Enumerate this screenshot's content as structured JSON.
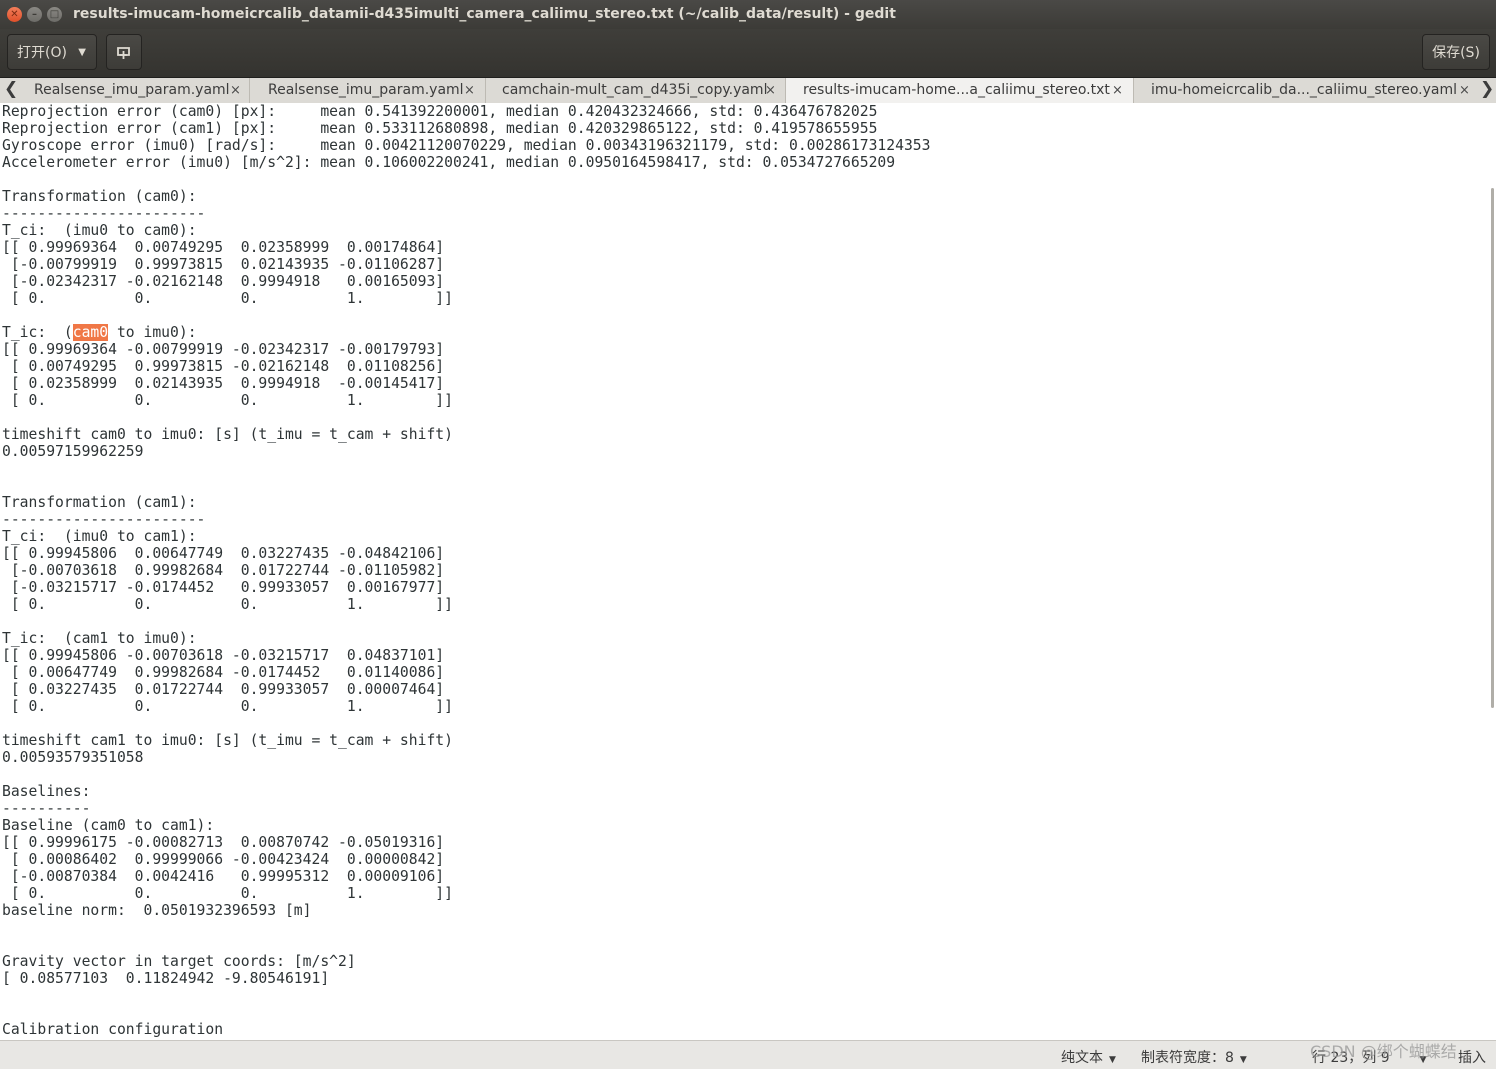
{
  "window": {
    "title": "results-imucam-homeicrcalib_datamii-d435imulti_camera_caliimu_stereo.txt (~/calib_data/result) - gedit"
  },
  "toolbar": {
    "open_label": "打开(O)",
    "save_label": "保存(S)"
  },
  "tabs": [
    {
      "label": "Realsense_imu_param.yaml",
      "active": false
    },
    {
      "label": "Realsense_imu_param.yaml",
      "active": false
    },
    {
      "label": "camchain-mult_cam_d435i_copy.yaml",
      "active": false
    },
    {
      "label": "results-imucam-home...a_caliimu_stereo.txt",
      "active": true
    },
    {
      "label": "imu-homeicrcalib_da..._caliimu_stereo.yaml",
      "active": false
    }
  ],
  "tab_close_glyph": "×",
  "editor": {
    "highlight": "cam0",
    "lines": [
      "Reprojection error (cam0) [px]:     mean 0.541392200001, median 0.420432324666, std: 0.436476782025",
      "Reprojection error (cam1) [px]:     mean 0.533112680898, median 0.420329865122, std: 0.419578655955",
      "Gyroscope error (imu0) [rad/s]:     mean 0.00421120070229, median 0.00343196321179, std: 0.00286173124353",
      "Accelerometer error (imu0) [m/s^2]: mean 0.106002200241, median 0.0950164598417, std: 0.0534727665209",
      "",
      "Transformation (cam0):",
      "-----------------------",
      "T_ci:  (imu0 to cam0): ",
      "[[ 0.99969364  0.00749295  0.02358999  0.00174864]",
      " [-0.00799919  0.99973815  0.02143935 -0.01106287]",
      " [-0.02342317 -0.02162148  0.9994918   0.00165093]",
      " [ 0.          0.          0.          1.        ]]",
      "",
      "T_ic:  (cam0 to imu0): ",
      "[[ 0.99969364 -0.00799919 -0.02342317 -0.00179793]",
      " [ 0.00749295  0.99973815 -0.02162148  0.01108256]",
      " [ 0.02358999  0.02143935  0.9994918  -0.00145417]",
      " [ 0.          0.          0.          1.        ]]",
      "",
      "timeshift cam0 to imu0: [s] (t_imu = t_cam + shift)",
      "0.00597159962259",
      "",
      "",
      "Transformation (cam1):",
      "-----------------------",
      "T_ci:  (imu0 to cam1): ",
      "[[ 0.99945806  0.00647749  0.03227435 -0.04842106]",
      " [-0.00703618  0.99982684  0.01722744 -0.01105982]",
      " [-0.03215717 -0.0174452   0.99933057  0.00167977]",
      " [ 0.          0.          0.          1.        ]]",
      "",
      "T_ic:  (cam1 to imu0): ",
      "[[ 0.99945806 -0.00703618 -0.03215717  0.04837101]",
      " [ 0.00647749  0.99982684 -0.0174452   0.01140086]",
      " [ 0.03227435  0.01722744  0.99933057  0.00007464]",
      " [ 0.          0.          0.          1.        ]]",
      "",
      "timeshift cam1 to imu0: [s] (t_imu = t_cam + shift)",
      "0.00593579351058",
      "",
      "Baselines:",
      "----------",
      "Baseline (cam0 to cam1): ",
      "[[ 0.99996175 -0.00082713  0.00870742 -0.05019316]",
      " [ 0.00086402  0.99999066 -0.00423424  0.00000842]",
      " [-0.00870384  0.0042416   0.99995312  0.00009106]",
      " [ 0.          0.          0.          1.        ]]",
      "baseline norm:  0.0501932396593 [m]",
      "",
      "",
      "Gravity vector in target coords: [m/s^2]",
      "[ 0.08577103  0.11824942 -9.80546191]",
      "",
      "",
      "Calibration configuration"
    ]
  },
  "statusbar": {
    "language": "纯文本",
    "tab_width": "制表符宽度：8",
    "position": "行 23，列 9",
    "mode": "插入"
  },
  "watermark": "CSDN @绑个蝴蝶结"
}
